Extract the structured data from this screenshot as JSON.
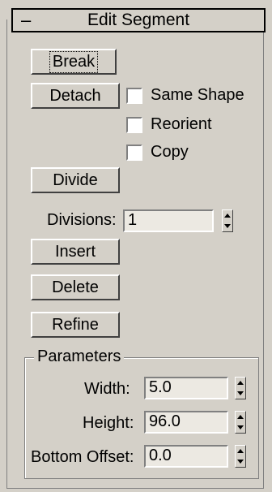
{
  "rollout": {
    "collapse_symbol": "–",
    "title": "Edit Segment"
  },
  "buttons": {
    "break": "Break",
    "detach": "Detach",
    "divide": "Divide",
    "insert": "Insert",
    "delete": "Delete",
    "refine": "Refine"
  },
  "checkboxes": {
    "same_shape": "Same Shape",
    "reorient": "Reorient",
    "copy": "Copy"
  },
  "divisions": {
    "label": "Divisions:",
    "value": "1"
  },
  "parameters": {
    "title": "Parameters",
    "width_label": "Width:",
    "width_value": "5.0",
    "height_label": "Height:",
    "height_value": "96.0",
    "bottom_offset_label": "Bottom Offset:",
    "bottom_offset_value": "0.0"
  }
}
